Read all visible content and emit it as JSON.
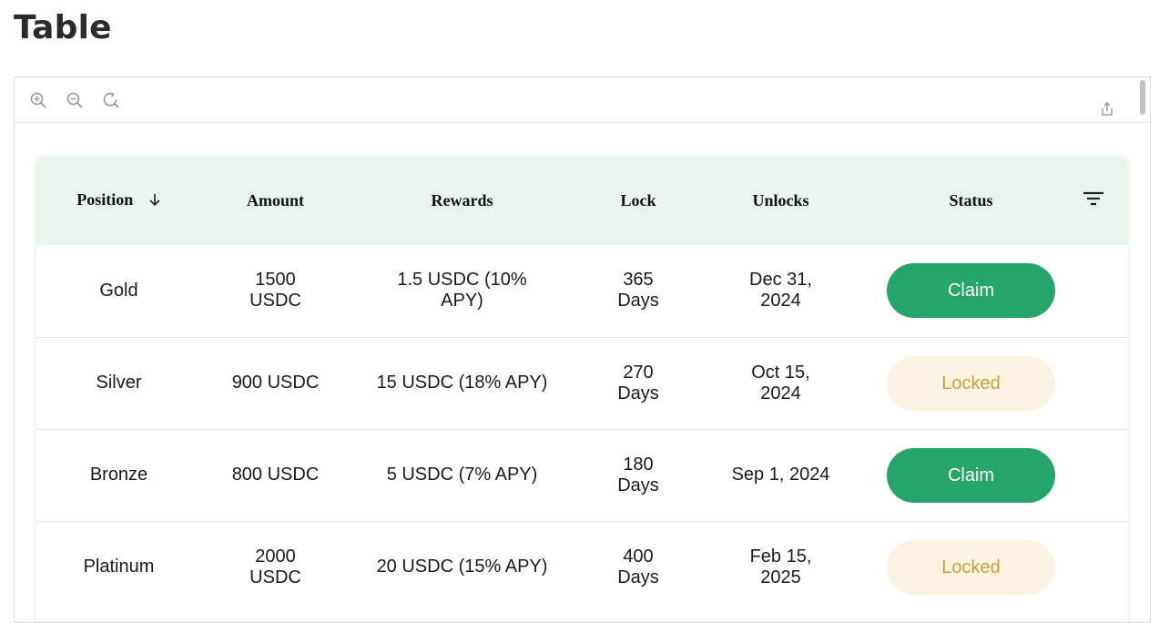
{
  "page": {
    "title": "Table"
  },
  "toolbar": {
    "zoom_in_icon": "zoom-in-icon",
    "zoom_out_icon": "zoom-out-icon",
    "reset_icon": "reset-icon",
    "share_icon": "share-icon"
  },
  "table": {
    "columns": [
      "Position",
      "Amount",
      "Rewards",
      "Lock",
      "Unlocks",
      "Status"
    ],
    "sort_icon": "arrow-down-icon",
    "filter_icon": "filter-icon",
    "rows": [
      {
        "position": "Gold",
        "amount": "1500 USDC",
        "rewards": "1.5 USDC (10% APY)",
        "lock": "365 Days",
        "unlocks": "Dec 31, 2024",
        "status": "Claim"
      },
      {
        "position": "Silver",
        "amount": "900 USDC",
        "rewards": "15 USDC (18% APY)",
        "lock": "270 Days",
        "unlocks": "Oct 15, 2024",
        "status": "Locked"
      },
      {
        "position": "Bronze",
        "amount": "800 USDC",
        "rewards": "5 USDC (7% APY)",
        "lock": "180 Days",
        "unlocks": "Sep 1, 2024",
        "status": "Claim"
      },
      {
        "position": "Platinum",
        "amount": "2000 USDC",
        "rewards": "20 USDC (15% APY)",
        "lock": "400 Days",
        "unlocks": "Feb 15, 2025",
        "status": "Locked"
      }
    ]
  },
  "colors": {
    "header_bg": "#e8f5ec",
    "claim_bg": "#26a56a",
    "claim_text": "#ffffff",
    "locked_bg": "#fdf3e2",
    "locked_text": "#d39b3a"
  }
}
